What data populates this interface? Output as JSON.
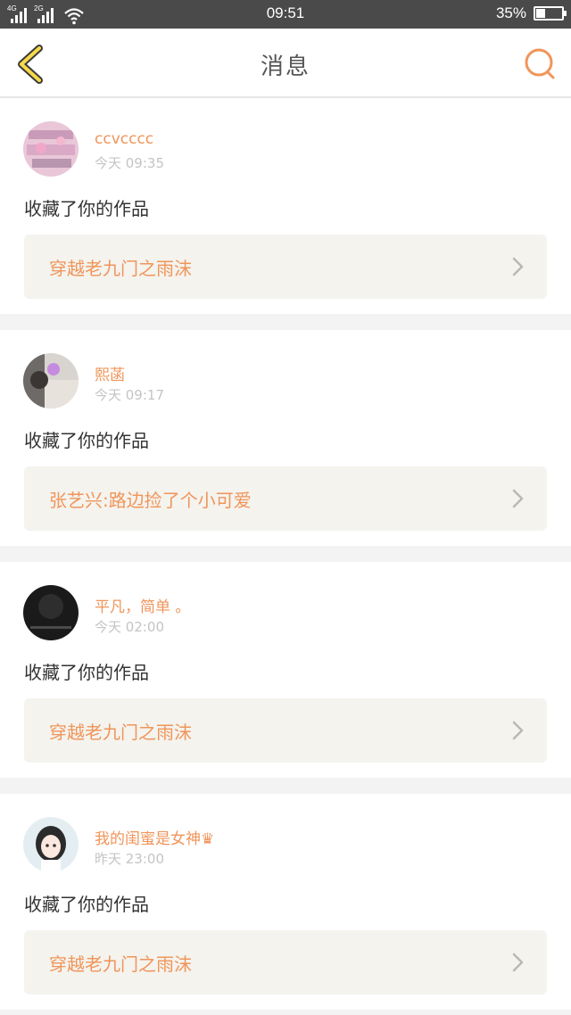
{
  "status_bar": {
    "net1": "4G",
    "net2": "2G",
    "time": "09:51",
    "battery_text": "35%",
    "battery_level": 0.35
  },
  "header": {
    "title": "消息",
    "back_icon": "chevron-left-icon",
    "search_icon": "search-icon",
    "accent_color": "#f0955a"
  },
  "messages": [
    {
      "user": "ccvcccc",
      "time": "今天 09:35",
      "action": "收藏了你的作品",
      "work": "穿越老九门之雨沫"
    },
    {
      "user": "熙菡",
      "time": "今天 09:17",
      "action": "收藏了你的作品",
      "work": "张艺兴:路边捡了个小可爱"
    },
    {
      "user": "平凡，简单 。",
      "time": "今天 02:00",
      "action": "收藏了你的作品",
      "work": "穿越老九门之雨沫"
    },
    {
      "user": "我的闺蜜是女神♛",
      "time": "昨天 23:00",
      "action": "收藏了你的作品",
      "work": "穿越老九门之雨沫"
    }
  ]
}
